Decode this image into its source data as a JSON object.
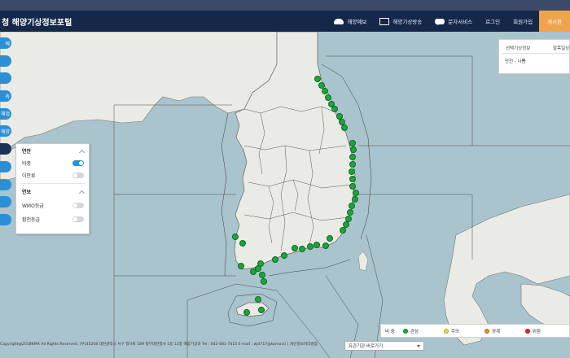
{
  "header": {
    "title": "청 해양기상정보포털",
    "nav": [
      {
        "label": "해양예보",
        "icon": "cloud-icon"
      },
      {
        "label": "해양기상방송",
        "icon": "monitor-icon"
      },
      {
        "label": "문자서비스",
        "icon": "chat-icon"
      },
      {
        "label": "로그인"
      },
      {
        "label": "회원가입"
      },
      {
        "label": "게시판"
      }
    ]
  },
  "sidebar": {
    "tabs": [
      "예",
      "",
      "",
      "측",
      "해업",
      "해양",
      "",
      "",
      "",
      "",
      ""
    ]
  },
  "layer_panel": {
    "group1": {
      "title": "연안"
    },
    "items1": [
      {
        "label": "비중",
        "on": true
      },
      {
        "label": "이안류",
        "on": false
      }
    ],
    "group2": {
      "title": "연보"
    },
    "items2": [
      {
        "label": "WMO등급",
        "on": false
      },
      {
        "label": "황천등급",
        "on": false
      }
    ]
  },
  "info_panel": {
    "col1": "선택기상정보",
    "col2": "항목일상",
    "value": "안전 - 나쁨"
  },
  "status_legend": {
    "prefix": "비 중",
    "items": [
      {
        "label": "관심",
        "color": "#1ea53a"
      },
      {
        "label": "주의",
        "color": "#f2d23c"
      },
      {
        "label": "경계",
        "color": "#f08a24"
      },
      {
        "label": "위험",
        "color": "#e3262b"
      }
    ]
  },
  "shortcut": {
    "label": "유관기관 바로가기"
  },
  "footer": {
    "text": "Copyright@2018KMA All Rights Reserved. (우)35208 대전광역시 서구 청사로 189 정부대전청사 1동 12층 해양기상과 Tel : 042-481-7415 E-mail : wjd717@korea.kr  |  개인정보처리방침"
  },
  "colors": {
    "header_bg": "#15284a",
    "accent": "#2b8fd6",
    "highlight": "#f0a34a",
    "sea": "#a9c4cc",
    "land": "#ebebe6"
  }
}
